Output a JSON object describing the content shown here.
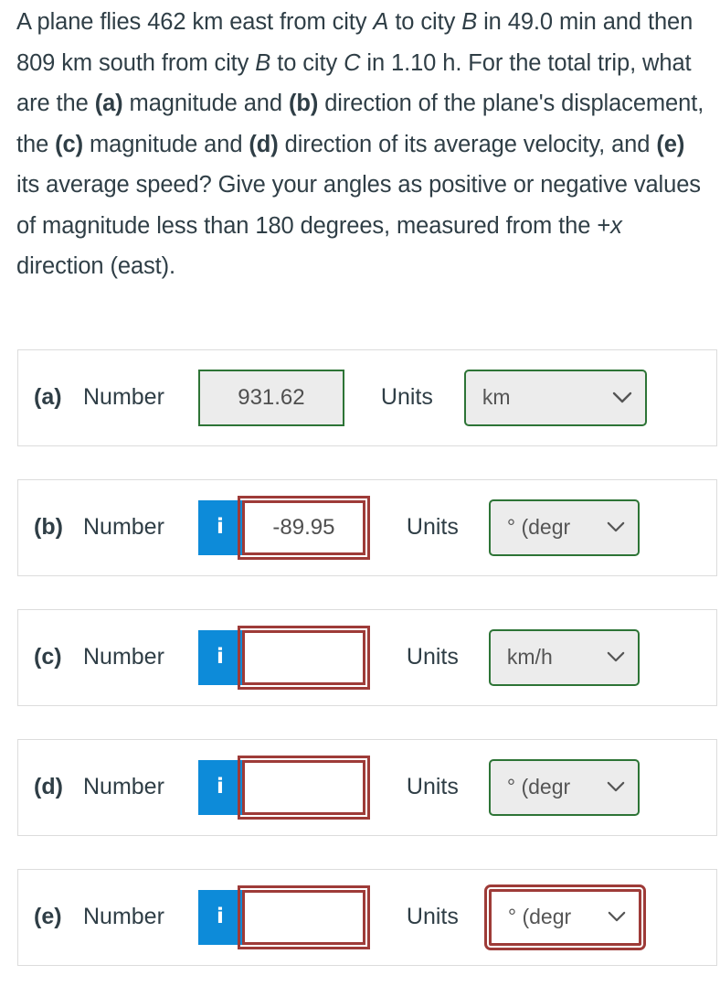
{
  "question": {
    "segments": [
      {
        "t": "A plane flies 462 km east from city ",
        "s": "n"
      },
      {
        "t": "A",
        "s": "i"
      },
      {
        "t": " to city ",
        "s": "n"
      },
      {
        "t": "B",
        "s": "i"
      },
      {
        "t": " in 49.0 min and then 809 km south from city ",
        "s": "n"
      },
      {
        "t": "B",
        "s": "i"
      },
      {
        "t": " to city ",
        "s": "n"
      },
      {
        "t": "C",
        "s": "i"
      },
      {
        "t": " in 1.10 h. For the total trip, what are the ",
        "s": "n"
      },
      {
        "t": "(a)",
        "s": "b"
      },
      {
        "t": " magnitude and ",
        "s": "n"
      },
      {
        "t": "(b)",
        "s": "b"
      },
      {
        "t": " direction of the plane's displacement, the ",
        "s": "n"
      },
      {
        "t": "(c)",
        "s": "b"
      },
      {
        "t": " magnitude and ",
        "s": "n"
      },
      {
        "t": "(d)",
        "s": "b"
      },
      {
        "t": " direction of its average velocity, and ",
        "s": "n"
      },
      {
        "t": "(e)",
        "s": "b"
      },
      {
        "t": " its average speed? Give your angles as positive or negative values of magnitude less than 180 degrees, measured from the +",
        "s": "n"
      },
      {
        "t": "x",
        "s": "i"
      },
      {
        "t": " direction (east).",
        "s": "n"
      }
    ]
  },
  "colors": {
    "accent_blue": "#0d8bd9",
    "correct_green": "#2d7436",
    "error_red": "#9e3b38",
    "card_border": "#dcdcdc",
    "field_fill": "#ececec",
    "text": "#2f3e46"
  },
  "labels": {
    "number": "Number",
    "units": "Units",
    "info_glyph": "i",
    "chevron": "chevron-down"
  },
  "rows": [
    {
      "tag": "(a)",
      "number_label": "Number",
      "units_label": "Units",
      "value": "931.62",
      "value_state": "correct",
      "has_info": false,
      "unit_value": "km",
      "unit_state": "correct"
    },
    {
      "tag": "(b)",
      "number_label": "Number",
      "units_label": "Units",
      "value": "-89.95",
      "value_state": "incorrect",
      "has_info": true,
      "unit_value": "° (degr",
      "unit_state": "correct"
    },
    {
      "tag": "(c)",
      "number_label": "Number",
      "units_label": "Units",
      "value": "",
      "value_state": "incorrect",
      "has_info": true,
      "unit_value": "km/h",
      "unit_state": "correct"
    },
    {
      "tag": "(d)",
      "number_label": "Number",
      "units_label": "Units",
      "value": "",
      "value_state": "incorrect",
      "has_info": true,
      "unit_value": "° (degr",
      "unit_state": "correct"
    },
    {
      "tag": "(e)",
      "number_label": "Number",
      "units_label": "Units",
      "value": "",
      "value_state": "incorrect",
      "has_info": true,
      "unit_value": "° (degr",
      "unit_state": "incorrect"
    }
  ]
}
